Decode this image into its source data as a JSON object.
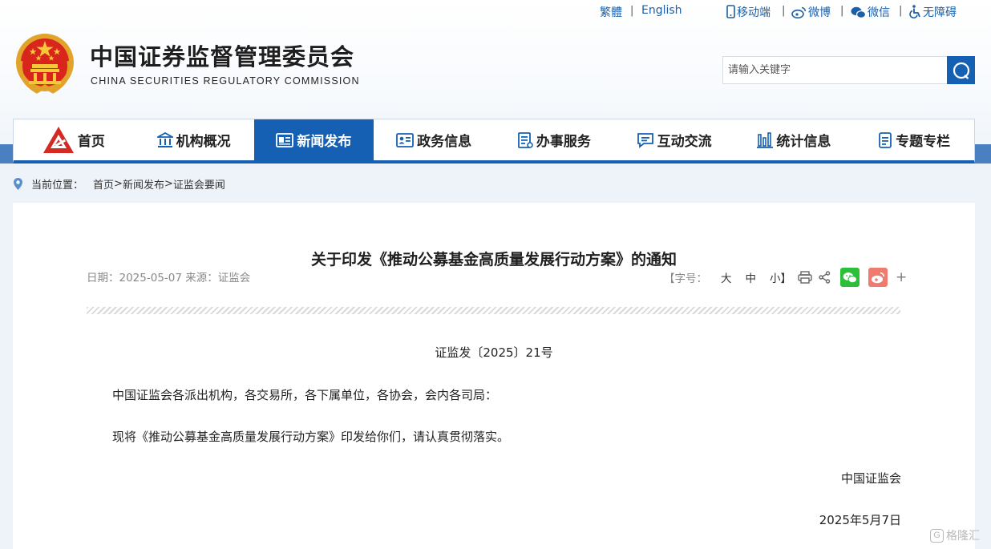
{
  "top_links": {
    "traditional": "繁體",
    "english": "English",
    "mobile": "移动端",
    "weibo": "微博",
    "wechat": "微信",
    "accessibility": "无障碍",
    "separator": "|"
  },
  "brand": {
    "title": "中国证券监督管理委员会",
    "subtitle": "CHINA SECURITIES REGULATORY COMMISSION"
  },
  "search": {
    "placeholder": "请输入关键字"
  },
  "nav": {
    "items": [
      {
        "label": "首页",
        "icon": "csrc-logo-icon"
      },
      {
        "label": "机构概况",
        "icon": "building-icon"
      },
      {
        "label": "新闻发布",
        "icon": "newspaper-icon",
        "active": true
      },
      {
        "label": "政务信息",
        "icon": "id-card-icon"
      },
      {
        "label": "办事服务",
        "icon": "document-list-icon"
      },
      {
        "label": "互动交流",
        "icon": "chat-bubble-icon"
      },
      {
        "label": "统计信息",
        "icon": "bar-chart-icon"
      },
      {
        "label": "专题专栏",
        "icon": "notepad-icon"
      }
    ]
  },
  "breadcrumb": {
    "prefix": "当前位置：",
    "items": [
      "首页",
      "新闻发布",
      "证监会要闻"
    ],
    "sep": ">"
  },
  "article": {
    "title": "关于印发《推动公募基金高质量发展行动方案》的通知",
    "meta": "日期：2025-05-07 来源：证监会",
    "font_size_label": "【字号：",
    "font_sizes": [
      "大",
      "中",
      "小】"
    ],
    "doc_number": "证监发〔2025〕21号",
    "paragraph_1": "中国证监会各派出机构，各交易所，各下属单位，各协会，会内各司局：",
    "paragraph_2": "现将《推动公募基金高质量发展行动方案》印发给你们，请认真贯彻落实。",
    "signature": "中国证监会",
    "date": "2025年5月7日"
  },
  "watermark": {
    "text": "格隆汇",
    "badge": "G"
  },
  "colors": {
    "brand_blue": "#1660b4",
    "link_blue": "#1a5fa8",
    "wechat_green": "#2bbf3a",
    "weibo_red": "#ee7b6e"
  }
}
